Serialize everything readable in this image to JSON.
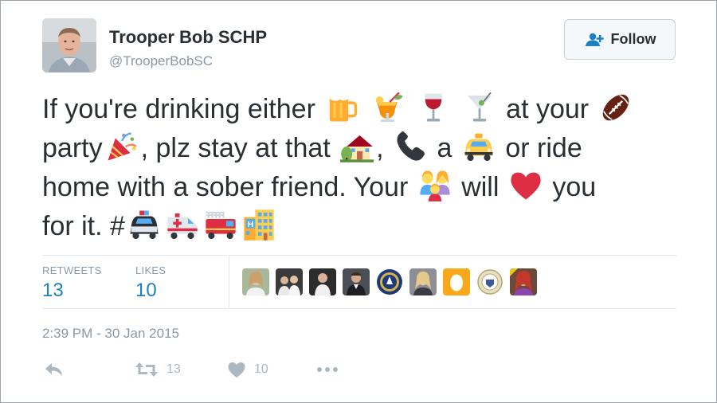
{
  "author": {
    "display_name": "Trooper Bob SCHP",
    "handle": "@TrooperBobSC"
  },
  "follow_button": {
    "label": "Follow",
    "icon": "add-user-icon"
  },
  "tweet": {
    "seg1": "If you're drinking either",
    "seg2": "at your",
    "seg3": "party",
    "seg4": ", plz stay at that",
    "seg5": ",",
    "seg6": "a",
    "seg7": "or ride",
    "seg8": "home with a sober friend. Your",
    "seg9": "will",
    "seg10": "you",
    "seg11": "for it. #",
    "emojis": [
      "beer-mug",
      "tropical-drink",
      "wine-glass",
      "cocktail-glass",
      "football",
      "party-popper",
      "house-with-garden",
      "telephone-receiver",
      "taxi",
      "family",
      "red-heart",
      "police-car",
      "ambulance",
      "fire-engine",
      "hotel"
    ]
  },
  "stats": {
    "retweets_label": "RETWEETS",
    "retweets_value": "13",
    "likes_label": "LIKES",
    "likes_value": "10"
  },
  "likers": [
    "liker-1",
    "liker-2",
    "liker-3",
    "liker-4",
    "liker-5",
    "liker-6",
    "liker-7",
    "liker-8",
    "liker-9",
    "liker-10"
  ],
  "timestamp": "2:39 PM - 30 Jan 2015",
  "actions": {
    "reply_icon": "reply-icon",
    "retweet_count": "13",
    "like_count": "10",
    "more_icon": "more-icon"
  },
  "colors": {
    "accent": "#1b7fc4",
    "muted": "#8899a6",
    "text": "#292f33",
    "border": "#e1e8ed"
  }
}
